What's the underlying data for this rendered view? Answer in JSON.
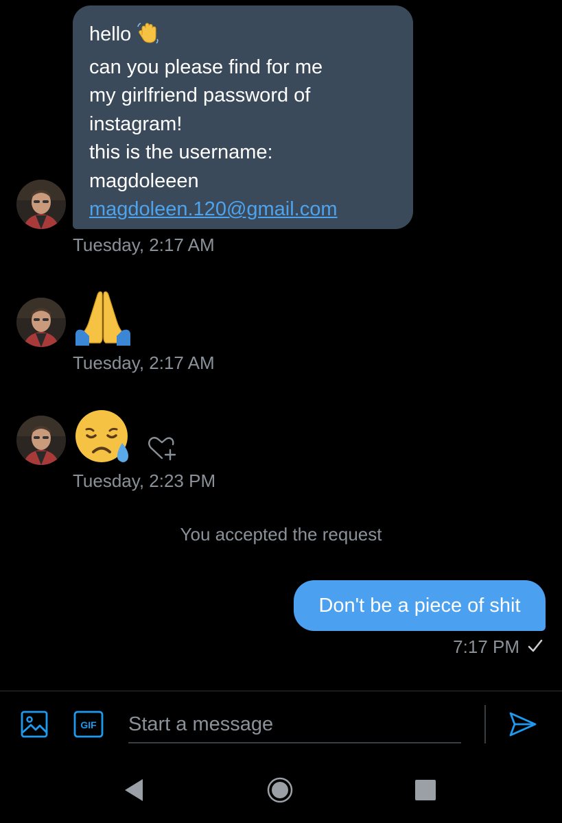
{
  "conversation": {
    "incoming_message": {
      "lines": [
        "hello",
        "can you please find for me",
        "my girlfriend password of",
        "instagram!",
        "this is the username:",
        "magdoleeen"
      ],
      "email_link": "magdoleen.120@gmail.com",
      "inline_emoji": "waving-hand-emoji",
      "timestamp": "Tuesday, 2:17 AM"
    },
    "emoji_message_1": {
      "emoji": "folded-hands-emoji",
      "timestamp": "Tuesday, 2:17 AM"
    },
    "emoji_message_2": {
      "emoji": "sad-relieved-face-emoji",
      "timestamp": "Tuesday, 2:23 PM"
    },
    "system_message": "You accepted the request",
    "outgoing_message": {
      "text": "Don't be a piece of shit",
      "timestamp": "7:17 PM",
      "status_icon": "checkmark-icon"
    }
  },
  "composer": {
    "placeholder": "Start a message",
    "gif_label": "GIF",
    "icons": [
      "image-icon",
      "gif-icon",
      "send-icon"
    ]
  },
  "navigation": {
    "icons": [
      "back-icon",
      "home-icon",
      "recents-icon"
    ]
  },
  "colors": {
    "background": "#000000",
    "incoming_bubble": "#3b4a5a",
    "outgoing_bubble": "#4ba0ef",
    "link": "#4da3ee",
    "muted_text": "#8a9199",
    "accent": "#1d9bf0"
  }
}
